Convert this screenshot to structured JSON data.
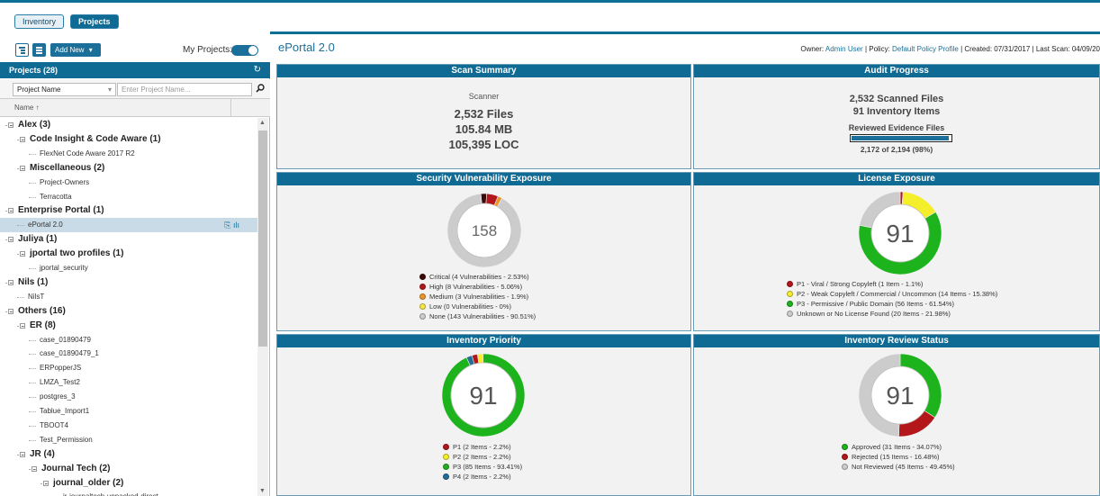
{
  "top_tabs": {
    "inventory": "Inventory",
    "projects": "Projects"
  },
  "toolbar": {
    "add_new": "Add New",
    "add_new_caret": "▾",
    "my_projects": "My Projects:"
  },
  "projects_panel": {
    "title": "Projects (28)",
    "refresh_icon": "↻",
    "filter_select": "Project Name",
    "filter_placeholder": "Enter Project Name...",
    "search_icon": "⚲",
    "col_name": "Name ↑"
  },
  "tree": [
    {
      "label": "Alex (3)",
      "level": 0,
      "bold": true
    },
    {
      "label": "Code Insight & Code Aware (1)",
      "level": 1,
      "bold": true
    },
    {
      "label": "FlexNet Code Aware 2017 R2",
      "level": 2,
      "bold": false
    },
    {
      "label": "Miscellaneous (2)",
      "level": 1,
      "bold": true
    },
    {
      "label": "Project-Owners",
      "level": 2,
      "bold": false
    },
    {
      "label": "Terracotta",
      "level": 2,
      "bold": false
    },
    {
      "label": "Enterprise Portal (1)",
      "level": 0,
      "bold": true
    },
    {
      "label": "ePortal 2.0",
      "level": 1,
      "bold": false,
      "selected": true
    },
    {
      "label": "Juliya (1)",
      "level": 0,
      "bold": true
    },
    {
      "label": "jportal two profiles (1)",
      "level": 1,
      "bold": true
    },
    {
      "label": "jportal_security",
      "level": 2,
      "bold": false
    },
    {
      "label": "Nils (1)",
      "level": 0,
      "bold": true
    },
    {
      "label": "NilsT",
      "level": 1,
      "bold": false
    },
    {
      "label": "Others (16)",
      "level": 0,
      "bold": true
    },
    {
      "label": "ER (8)",
      "level": 1,
      "bold": true
    },
    {
      "label": "case_01890479",
      "level": 2,
      "bold": false
    },
    {
      "label": "case_01890479_1",
      "level": 2,
      "bold": false
    },
    {
      "label": "ERPopperJS",
      "level": 2,
      "bold": false
    },
    {
      "label": "LMZA_Test2",
      "level": 2,
      "bold": false
    },
    {
      "label": "postgres_3",
      "level": 2,
      "bold": false
    },
    {
      "label": "Tablue_Import1",
      "level": 2,
      "bold": false
    },
    {
      "label": "TBOOT4",
      "level": 2,
      "bold": false
    },
    {
      "label": "Test_Permission",
      "level": 2,
      "bold": false
    },
    {
      "label": "JR (4)",
      "level": 1,
      "bold": true
    },
    {
      "label": "Journal Tech (2)",
      "level": 2,
      "bold": true
    },
    {
      "label": "journal_older (2)",
      "level": 3,
      "bold": true
    },
    {
      "label": "jr-journaltech-unpacked-direct",
      "level": 4,
      "bold": false
    }
  ],
  "selected_row_icons": "⎘ ılı",
  "project": {
    "title": "ePortal 2.0",
    "owner_label": "Owner: ",
    "owner": "Admin User",
    "policy_label": " | Policy: ",
    "policy": "Default Policy Profile",
    "created": " | Created: 07/31/2017 | Last Scan: 04/09/20"
  },
  "scan_summary": {
    "title": "Scan Summary",
    "scanner": "Scanner",
    "files": "2,532 Files",
    "size": "105.84 MB",
    "loc": "105,395 LOC"
  },
  "audit_progress": {
    "title": "Audit Progress",
    "scanned": "2,532 Scanned Files",
    "inventory": "91 Inventory Items",
    "reviewed_label": "Reviewed Evidence Files",
    "progress": 0.98,
    "progress_text": "2,172 of 2,194 (98%)"
  },
  "security": {
    "title": "Security Vulnerability Exposure",
    "total": "158",
    "legend": [
      {
        "label": "Critical (4 Vulnerabilities - 2.53%)",
        "value": 2.53,
        "color": "#3d0a0a"
      },
      {
        "label": "High (8 Vulnerabilities - 5.06%)",
        "value": 5.06,
        "color": "#b3171b"
      },
      {
        "label": "Medium (3 Vulnerabilities - 1.9%)",
        "value": 1.9,
        "color": "#e8952a"
      },
      {
        "label": "Low (0 Vulnerabilities - 0%)",
        "value": 0,
        "color": "#f5e64a"
      },
      {
        "label": "None (143 Vulnerabilities - 90.51%)",
        "value": 90.51,
        "color": "#cccccc"
      }
    ]
  },
  "license": {
    "title": "License Exposure",
    "total": "91",
    "legend": [
      {
        "label": "P1 - Viral / Strong Copyleft (1 Item - 1.1%)",
        "value": 1.1,
        "color": "#b3171b"
      },
      {
        "label": "P2 - Weak Copyleft / Commercial / Uncommon (14 Items - 15.38%)",
        "value": 15.38,
        "color": "#f5ee2a"
      },
      {
        "label": "P3 - Permissive / Public Domain (56 Items - 61.54%)",
        "value": 61.54,
        "color": "#1db31d"
      },
      {
        "label": "Unknown or No License Found (20 Items - 21.98%)",
        "value": 21.98,
        "color": "#cccccc"
      }
    ]
  },
  "inventory_priority": {
    "title": "Inventory Priority",
    "total": "91",
    "legend": [
      {
        "label": "P1 (2 Items - 2.2%)",
        "value": 2.2,
        "color": "#b3171b"
      },
      {
        "label": "P2 (2 Items - 2.2%)",
        "value": 2.2,
        "color": "#f5ee2a"
      },
      {
        "label": "P3 (85 Items - 93.41%)",
        "value": 93.41,
        "color": "#1db31d"
      },
      {
        "label": "P4 (2 Items - 2.2%)",
        "value": 2.2,
        "color": "#236e96"
      }
    ]
  },
  "review_status": {
    "title": "Inventory Review Status",
    "total": "91",
    "legend": [
      {
        "label": "Approved (31 Items - 34.07%)",
        "value": 34.07,
        "color": "#1db31d"
      },
      {
        "label": "Rejected (15 Items - 16.48%)",
        "value": 16.48,
        "color": "#b3171b"
      },
      {
        "label": "Not Reviewed (45 Items - 49.45%)",
        "value": 49.45,
        "color": "#cccccc"
      }
    ]
  }
}
